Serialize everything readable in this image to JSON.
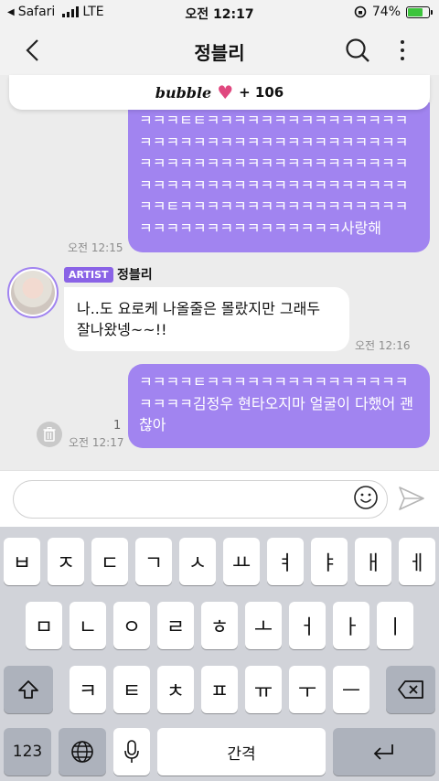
{
  "status": {
    "carrier_back": "Safari",
    "network": "LTE",
    "time": "오전 12:17",
    "battery": "74%",
    "battery_level": 0.74
  },
  "header": {
    "title": "정블리"
  },
  "bubble_bar": {
    "logo": "bubble",
    "count": "+ 106"
  },
  "messages": [
    {
      "text": "ㅋㅋㅋㅌㅌㅋㅋㅋㅋㅋㅋㅋㅋㅋㅋㅋㅋㅋㅋㅋㅋㅋㅋㅋㅋㅋㅋㅋㅋㅋㅋㅋㅋㅋㅋㅋㅋㅋㅋㅋㅋㅋㅋㅋㅋㅋㅋㅋㅋㅋㅋㅋㅋㅋㅋㅋㅋㅋㅋㅋㅋㅋㅋㅋㅋㅋㅋㅋㅋㅋㅋㅋㅋㅋㅋㅋㅋㅋㅋㅋㅋㅋㅌㅋㅋㅋㅋㅋㅋㅋㅋㅋㅋㅋㅋㅋㅋㅋㅋㅋㅋㅋㅋㅋㅋㅋㅋㅋㅋㅋㅋㅋㅋㅋㅋ사랑해",
      "time": "오전 12:15"
    },
    {
      "artist_badge": "ARTIST",
      "sender": "정블리",
      "text": "나..도 요로케 나올줄은 몰랐지만 그래두 잘나왔넹~~!!",
      "time": "오전 12:16"
    },
    {
      "text": "ㅋㅋㅋㅋㅌㅋㅋㅋㅋㅋㅋㅋㅋㅋㅋㅋㅋㅋㅋㅋㅋㅋㅋㅋ김정우 현타오지마 얼굴이 다했어 괜찮아",
      "time": "오전 12:17",
      "unread": "1"
    }
  ],
  "input": {
    "placeholder": ""
  },
  "keyboard": {
    "row1": [
      "ㅂ",
      "ㅈ",
      "ㄷ",
      "ㄱ",
      "ㅅ",
      "ㅛ",
      "ㅕ",
      "ㅑ",
      "ㅐ",
      "ㅔ"
    ],
    "row2": [
      "ㅁ",
      "ㄴ",
      "ㅇ",
      "ㄹ",
      "ㅎ",
      "ㅗ",
      "ㅓ",
      "ㅏ",
      "ㅣ"
    ],
    "row3": [
      "ㅋ",
      "ㅌ",
      "ㅊ",
      "ㅍ",
      "ㅠ",
      "ㅜ",
      "ㅡ"
    ],
    "num_label": "123",
    "space_label": "간격"
  },
  "colors": {
    "accent": "#a184f0",
    "badge": "#8a63e6",
    "heart": "#e0487f"
  }
}
